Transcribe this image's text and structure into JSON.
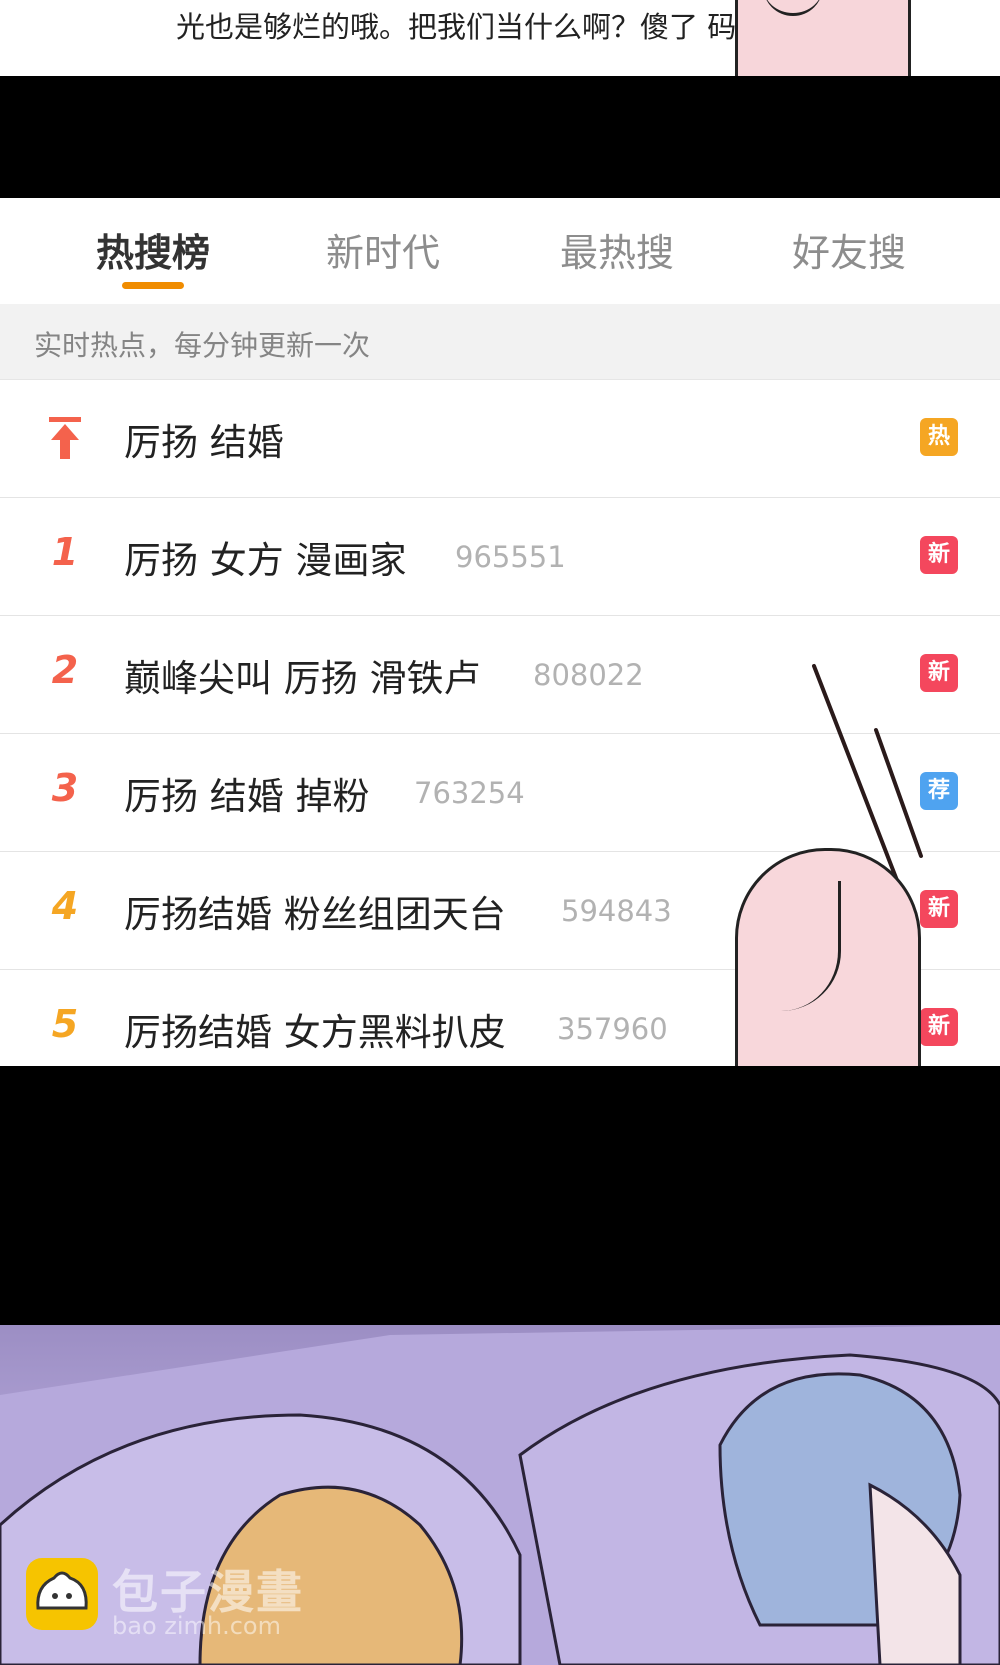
{
  "top_caption": "光也是够烂的哦。把我们当什么啊？傻了 码的",
  "tabs": [
    {
      "label": "热搜榜",
      "active": true
    },
    {
      "label": "新时代",
      "active": false
    },
    {
      "label": "最热搜",
      "active": false
    },
    {
      "label": "好友搜",
      "active": false
    }
  ],
  "subheader": "实时热点，每分钟更新一次",
  "rows": [
    {
      "rank": "",
      "topic": "厉扬 结婚",
      "count": "",
      "badge": "热",
      "badge_color": "#f5a623"
    },
    {
      "rank": "1",
      "topic": "厉扬 女方 漫画家",
      "count": "965551",
      "badge": "新",
      "badge_color": "#f4475d"
    },
    {
      "rank": "2",
      "topic": "巅峰尖叫 厉扬 滑铁卢",
      "count": "808022",
      "badge": "新",
      "badge_color": "#f4475d"
    },
    {
      "rank": "3",
      "topic": "厉扬 结婚 掉粉",
      "count": "763254",
      "badge": "荐",
      "badge_color": "#4fa3f0"
    },
    {
      "rank": "4",
      "topic": "厉扬结婚 粉丝组团天台",
      "count": "594843",
      "badge": "新",
      "badge_color": "#f4475d"
    },
    {
      "rank": "5",
      "topic": "厉扬结婚 女方黑料扒皮",
      "count": "357960",
      "badge": "新",
      "badge_color": "#f4475d"
    }
  ],
  "watermark": {
    "name": "包子漫畫",
    "url": "bao zimh.com"
  },
  "colors": {
    "rank_red": "#f4624c",
    "rank_orange": "#f5a623",
    "tab_underline": "#f08c00"
  },
  "icons": {
    "pinned": "pin-top-icon",
    "logo": "bun-logo-icon"
  }
}
